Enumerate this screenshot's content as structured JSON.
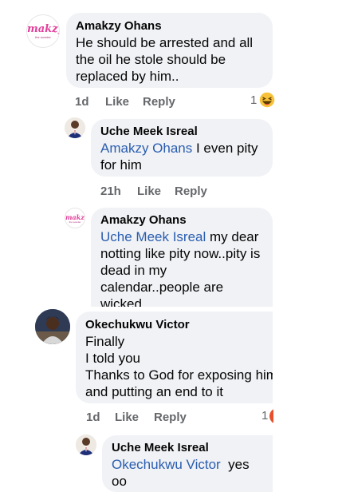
{
  "comments": [
    {
      "author": "Amakzy Ohans",
      "text": "He should be arrested and all\nthe oil he stole should be\nreplaced by him..",
      "meta": {
        "time": "1d",
        "like": "Like",
        "reply": "Reply"
      },
      "reaction_count": "1",
      "avatar_logo": "makzy",
      "avatar_logo_sub": "the wonder"
    },
    {
      "author": "Uche Meek Isreal",
      "mention": "Amakzy Ohans",
      "text": " I even pity\nfor him",
      "meta": {
        "time": "21h",
        "like": "Like",
        "reply": "Reply"
      }
    },
    {
      "author": "Amakzy Ohans",
      "mention": "Uche Meek Isreal",
      "text": " my dear\nnotting like pity now..pity is\ndead in my\ncalendar..people are\nwicked",
      "avatar_logo": "makzy",
      "avatar_logo_sub": "the wonder"
    },
    {
      "author": "Okechukwu Victor",
      "text": "Finally\nI told you\nThanks to God for exposing him\nand putting an end to it",
      "meta": {
        "time": "1d",
        "like": "Like",
        "reply": "Reply"
      },
      "reaction_count": "1"
    },
    {
      "author": "Uche Meek Isreal",
      "mention": "Okechukwu Victor",
      "text": "  yes oo\nDaddy, No more loss"
    }
  ],
  "colors": {
    "bubble": "#f0f2f5",
    "mention": "#2a5db0",
    "meta": "#65676b",
    "logo": "#e23f9a"
  },
  "icons": [
    "laughing-emoji-icon",
    "angry-emoji-icon"
  ]
}
